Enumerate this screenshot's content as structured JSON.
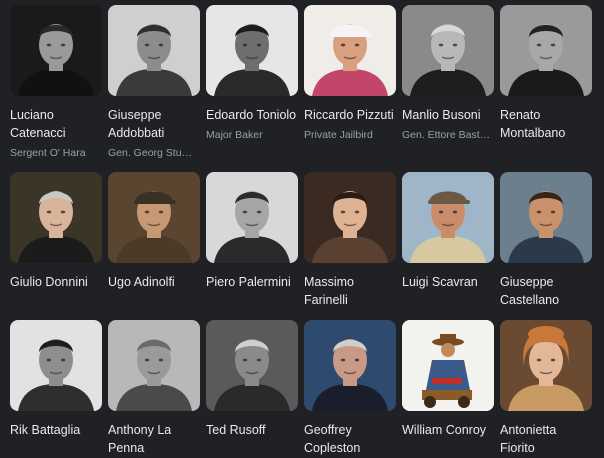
{
  "cast": [
    {
      "name": "Luciano Catenacci",
      "role": "Sergent O' Hara",
      "photo": "bw-dark-portrait",
      "bg": "#1a1a1a",
      "skin": "#9a9a9a",
      "hair": "#2a2a2a",
      "cloth": "#111111"
    },
    {
      "name": "Giuseppe Addobbati",
      "role": "Gen. Georg Stu…",
      "photo": "bw-portrait",
      "bg": "#cfcfcf",
      "skin": "#8c8c8c",
      "hair": "#2e2e2e",
      "cloth": "#3a3a3a"
    },
    {
      "name": "Edoardo Toniolo",
      "role": "Major Baker",
      "photo": "bw-portrait",
      "bg": "#e6e6e6",
      "skin": "#6e6e6e",
      "hair": "#1c1c1c",
      "cloth": "#2a2a2a"
    },
    {
      "name": "Riccardo Pizzuti",
      "role": "Private Jailbird",
      "photo": "color-portrait-cap",
      "bg": "#f0ede8",
      "skin": "#d9a07f",
      "hair": "#f4f4f4",
      "cloth": "#c2456a"
    },
    {
      "name": "Manlio Busoni",
      "role": "Gen. Ettore Bast…",
      "photo": "bw-portrait",
      "bg": "#8a8a8a",
      "skin": "#b8b8b8",
      "hair": "#d8d8d8",
      "cloth": "#1e1e1e"
    },
    {
      "name": "Renato Montalbano",
      "role": "",
      "photo": "bw-portrait",
      "bg": "#9a9a9a",
      "skin": "#a8a8a8",
      "hair": "#222222",
      "cloth": "#1a1a1a"
    },
    {
      "name": "Giulio Donnini",
      "role": "",
      "photo": "color-portrait",
      "bg": "#3b3528",
      "skin": "#d8b59a",
      "hair": "#c8c8c8",
      "cloth": "#1b1b1b"
    },
    {
      "name": "Ugo Adinolfi",
      "role": "",
      "photo": "color-portrait-cap",
      "bg": "#5a4630",
      "skin": "#c79874",
      "hair": "#3a3024",
      "cloth": "#4a3a26"
    },
    {
      "name": "Piero Palermini",
      "role": "",
      "photo": "bw-portrait",
      "bg": "#d8d8d8",
      "skin": "#a6a6a6",
      "hair": "#2c2c2c",
      "cloth": "#2a2a2a"
    },
    {
      "name": "Massimo Farinelli",
      "role": "",
      "photo": "color-portrait",
      "bg": "#3a2a22",
      "skin": "#e0b294",
      "hair": "#2a1c14",
      "cloth": "#5a4030"
    },
    {
      "name": "Luigi Scavran",
      "role": "",
      "photo": "color-portrait-cap",
      "bg": "#9fb6c8",
      "skin": "#c98d6a",
      "hair": "#6a5a44",
      "cloth": "#d8c8a0"
    },
    {
      "name": "Giuseppe Castellano",
      "role": "",
      "photo": "color-portrait",
      "bg": "#6b7f8c",
      "skin": "#c9926c",
      "hair": "#3a2418",
      "cloth": "#2a3a4a"
    },
    {
      "name": "Rik Battaglia",
      "role": "",
      "photo": "bw-portrait",
      "bg": "#e2e2e2",
      "skin": "#8e8e8e",
      "hair": "#1e1e1e",
      "cloth": "#2e2e2e"
    },
    {
      "name": "Anthony La Penna",
      "role": "",
      "photo": "bw-portrait",
      "bg": "#b8b8b8",
      "skin": "#9a9a9a",
      "hair": "#6a6a6a",
      "cloth": "#4a4a4a"
    },
    {
      "name": "Ted Rusoff",
      "role": "",
      "photo": "bw-portrait",
      "bg": "#5a5a5a",
      "skin": "#8a8a8a",
      "hair": "#cfcfcf",
      "cloth": "#2a2a2a"
    },
    {
      "name": "Geoffrey Copleston",
      "role": "",
      "photo": "color-portrait",
      "bg": "#2e4a6e",
      "skin": "#c89a86",
      "hair": "#cfcfcf",
      "cloth": "#1a1e2a"
    },
    {
      "name": "William Conroy",
      "role": "",
      "photo": "poster-art",
      "bg": "#f4f2ee",
      "skin": "#c08a5c",
      "hair": "#6a3a1a",
      "cloth": "#3a5a8a"
    },
    {
      "name": "Antonietta Fiorito",
      "role": "",
      "photo": "color-portrait-woman",
      "bg": "#6a4a30",
      "skin": "#e2b896",
      "hair": "#c8783a",
      "cloth": "#c89a64"
    }
  ]
}
